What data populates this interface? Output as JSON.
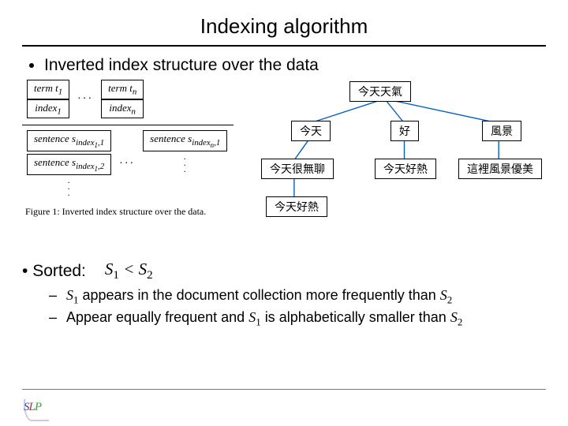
{
  "title": "Indexing algorithm",
  "bullet1": "Inverted index structure over the data",
  "fig": {
    "term1": "term t",
    "term1_sub": "1",
    "termN": "term t",
    "termN_sub": "n",
    "idx1": "index",
    "idx1_sub": "1",
    "idxN": "index",
    "idxN_sub": "n",
    "dots": "···",
    "s11a": "sentence s",
    "s11b": "index",
    "s11c": "1",
    "s11d": ",1",
    "s12a": "sentence s",
    "s12b": "index",
    "s12c": "1",
    "s12d": ",2",
    "sN1a": "sentence s",
    "sN1b": "index",
    "sN1c": "n",
    "sN1d": ",1",
    "caption": "Figure 1: Inverted index structure over the data."
  },
  "tree": {
    "root": "今天天氣",
    "a": "今天",
    "b": "好",
    "c": "風景",
    "a1": "今天很無聊",
    "b1": "今天好熱",
    "c1": "這裡風景優美",
    "a2": "今天好熱"
  },
  "sorted": {
    "label": "Sorted:",
    "cond": "S₁ < S₂",
    "line1a": "S₁",
    "line1b": "appears in the document collection more frequently than",
    "line1c": "S₂",
    "line2a": "Appear equally frequent and",
    "line2b": "S₁",
    "line2c": "is alphabetically smaller than",
    "line2d": "S₂"
  },
  "logo": {
    "s": "S",
    "l": "L",
    "p": "P"
  }
}
